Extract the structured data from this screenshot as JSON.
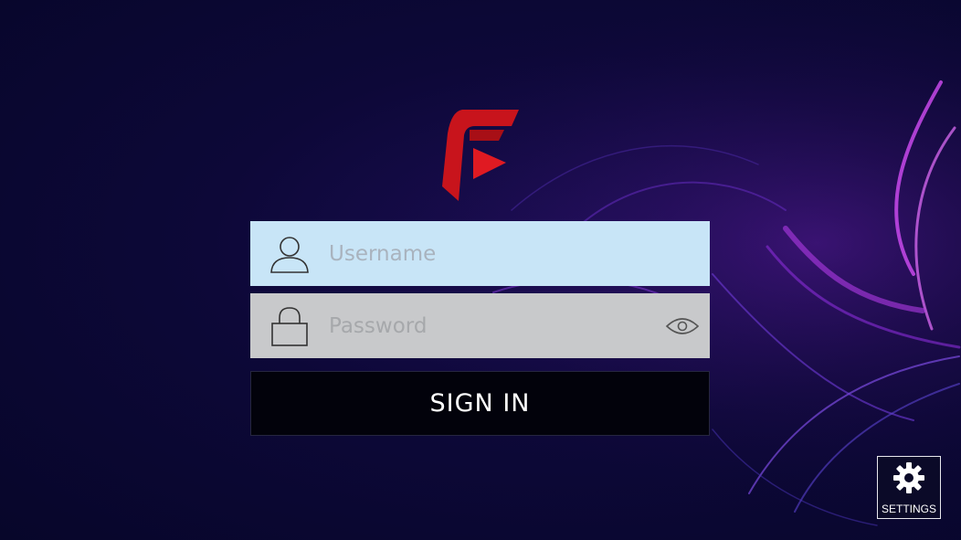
{
  "login": {
    "username_placeholder": "Username",
    "password_placeholder": "Password",
    "signin_label": "SIGN IN"
  },
  "settings": {
    "label": "SETTINGS"
  },
  "icons": {
    "logo": "app-logo",
    "user": "user-icon",
    "lock": "lock-icon",
    "eye": "eye-icon",
    "settings": "gear-icon"
  },
  "colors": {
    "background": "#0d0838",
    "username_field": "#c8e5f7",
    "password_field": "#c8c9cb",
    "signin_button": "#02020b",
    "logo_red": "#c8141c",
    "accent_purple": "#c040f0"
  }
}
